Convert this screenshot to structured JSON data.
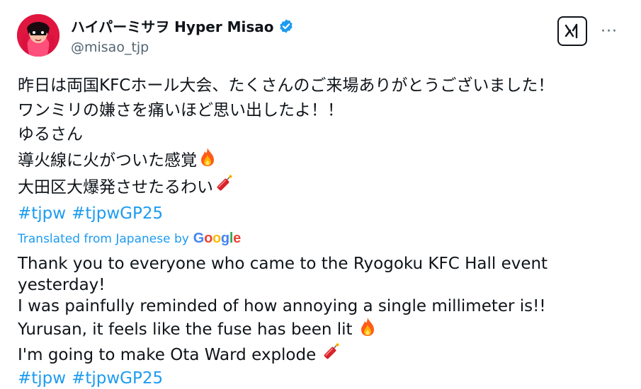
{
  "author": {
    "display_name": "ハイパーミサヲ Hyper Misao",
    "handle": "@misao_tjp",
    "verified_badge_color": "#1d9bf0"
  },
  "actions": {
    "grok_icon": "grok-icon",
    "more_icon": "more-icon",
    "more_label": "···"
  },
  "tweet_ja": {
    "line1": "昨日は両国KFCホール大会、たくさんのご来場ありがとうございました！",
    "line2": "ワンミリの嫌さを痛いほど思い出したよ！！",
    "line3": "ゆるさん",
    "line4": "導火線に火がついた感覚",
    "line5": "大田区大爆発させたるわい",
    "hashtags": [
      "#tjpw",
      "#tjpwGP25"
    ]
  },
  "translation": {
    "label": "Translated from Japanese by",
    "provider": "Google"
  },
  "tweet_en": {
    "line1": "Thank you to everyone who came to the Ryogoku KFC Hall event",
    "line2": "yesterday!",
    "line3": "I was painfully reminded of how annoying a single millimeter is!!",
    "line4": "Yurusan, it feels like the fuse has been lit",
    "line5": "I'm going to make Ota Ward explode",
    "hashtags": [
      "#tjpw",
      "#tjpwGP25"
    ]
  },
  "colors": {
    "link": "#1d9bf0",
    "text": "#0f1419",
    "muted": "#536471"
  }
}
